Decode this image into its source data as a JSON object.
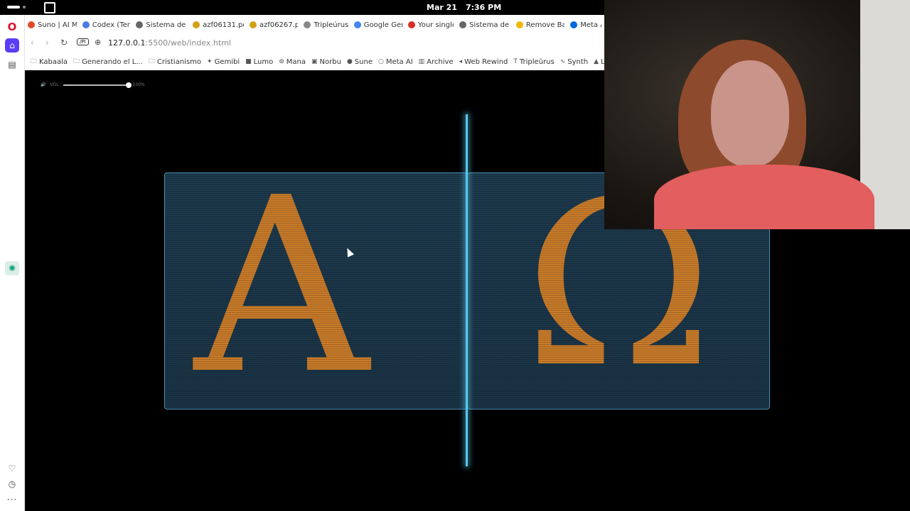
{
  "system_bar": {
    "date": "Mar 21",
    "time": "7:36 PM"
  },
  "tabs": [
    {
      "label": "Suno | AI Mu",
      "icon": "suno-icon",
      "color": "#e04a2a"
    },
    {
      "label": "Codex (Tene",
      "icon": "doc-icon",
      "color": "#4a7be0"
    },
    {
      "label": "Sistema de C",
      "icon": "file-icon",
      "color": "#666666"
    },
    {
      "label": "azf06131.pdf",
      "icon": "pdf-icon",
      "color": "#d4a017"
    },
    {
      "label": "azf06267.pd",
      "icon": "pdf-icon",
      "color": "#d4a017"
    },
    {
      "label": "Tripleúrus -",
      "icon": "globe-icon",
      "color": "#888888"
    },
    {
      "label": "Google Gem",
      "icon": "gemini-icon",
      "color": "#4285f4"
    },
    {
      "label": "Your single-",
      "icon": "gmail-icon",
      "color": "#d93025"
    },
    {
      "label": "Sistema de C",
      "icon": "file-icon",
      "color": "#666666"
    },
    {
      "label": "Remove Bac",
      "icon": "removebg-icon",
      "color": "#f2b705"
    },
    {
      "label": "Meta A",
      "icon": "meta-icon",
      "color": "#0668e1"
    }
  ],
  "address_bar": {
    "pi_badge": "/PI",
    "host": "127.0.0.1",
    "path": ":5500/web/index.html"
  },
  "bookmarks": [
    {
      "label": "Kabaala",
      "icon": "folder-icon"
    },
    {
      "label": "Generando el L...",
      "icon": "folder-icon"
    },
    {
      "label": "Cristianismo",
      "icon": "folder-icon"
    },
    {
      "label": "Gemibi",
      "icon": "gemini-icon"
    },
    {
      "label": "Lumo",
      "icon": "lumo-icon"
    },
    {
      "label": "Mana",
      "icon": "globe-icon"
    },
    {
      "label": "Norbu",
      "icon": "norbu-icon"
    },
    {
      "label": "Sune",
      "icon": "suno-icon"
    },
    {
      "label": "Meta AI",
      "icon": "meta-icon"
    },
    {
      "label": "Archive",
      "icon": "archive-icon"
    },
    {
      "label": "Web Rewind",
      "icon": "rewind-icon"
    },
    {
      "label": "Tripleŭrus",
      "icon": "t-icon"
    },
    {
      "label": "Synth",
      "icon": "wave-icon"
    },
    {
      "label": "L",
      "icon": "drive-icon"
    }
  ],
  "player": {
    "volume_label": "VOL",
    "volume_value": "100%",
    "volume_level": 1.0
  },
  "panels": {
    "left_glyph": "A",
    "right_glyph": "Ω"
  }
}
